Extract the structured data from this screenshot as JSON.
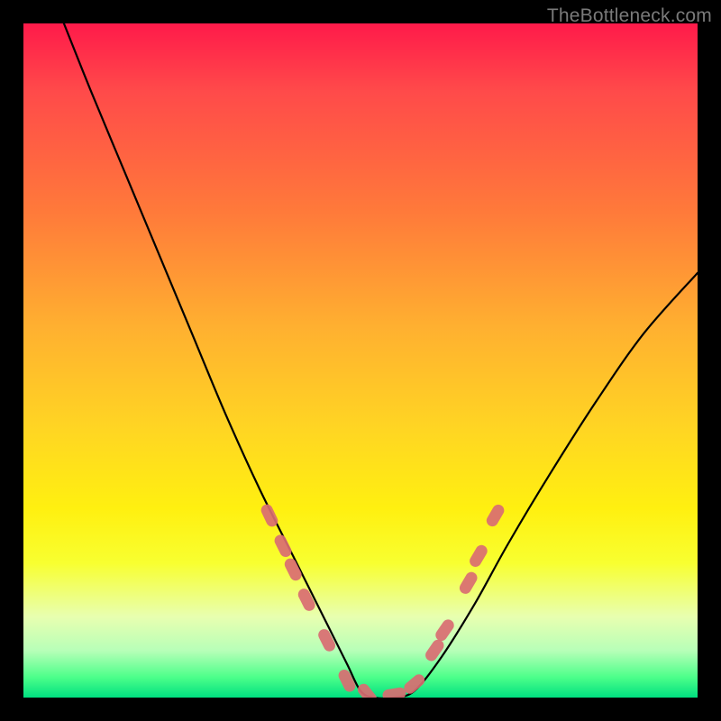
{
  "watermark": "TheBottleneck.com",
  "chart_data": {
    "type": "line",
    "title": "",
    "xlabel": "",
    "ylabel": "",
    "xlim": [
      0,
      100
    ],
    "ylim": [
      0,
      100
    ],
    "series": [
      {
        "name": "bottleneck-curve",
        "x": [
          6,
          10,
          15,
          20,
          25,
          30,
          35,
          40,
          45,
          48,
          50,
          52,
          55,
          58,
          62,
          67,
          72,
          78,
          85,
          92,
          100
        ],
        "y": [
          100,
          90,
          78,
          66,
          54,
          42,
          31,
          21,
          11,
          5,
          1,
          0,
          0,
          1,
          6,
          14,
          23,
          33,
          44,
          54,
          63
        ]
      }
    ],
    "markers": {
      "name": "highlighted-points",
      "color": "#d96d72",
      "points": [
        {
          "x": 36.5,
          "y": 27
        },
        {
          "x": 38.5,
          "y": 22.5
        },
        {
          "x": 40,
          "y": 19
        },
        {
          "x": 42,
          "y": 14.5
        },
        {
          "x": 45,
          "y": 8.5
        },
        {
          "x": 48,
          "y": 2.5
        },
        {
          "x": 51,
          "y": 0.5
        },
        {
          "x": 55,
          "y": 0.5
        },
        {
          "x": 58,
          "y": 2
        },
        {
          "x": 61,
          "y": 7
        },
        {
          "x": 62.5,
          "y": 10
        },
        {
          "x": 66,
          "y": 17
        },
        {
          "x": 67.5,
          "y": 21
        },
        {
          "x": 70,
          "y": 27
        }
      ]
    },
    "gradient_stops": [
      {
        "pos": 0,
        "color": "#ff1a4a"
      },
      {
        "pos": 10,
        "color": "#ff4a4a"
      },
      {
        "pos": 28,
        "color": "#ff7a3a"
      },
      {
        "pos": 45,
        "color": "#ffb030"
      },
      {
        "pos": 60,
        "color": "#ffd523"
      },
      {
        "pos": 72,
        "color": "#fff010"
      },
      {
        "pos": 80,
        "color": "#f8ff30"
      },
      {
        "pos": 88,
        "color": "#e8ffb0"
      },
      {
        "pos": 93,
        "color": "#b8ffb8"
      },
      {
        "pos": 97,
        "color": "#4cff8a"
      },
      {
        "pos": 100,
        "color": "#00e080"
      }
    ]
  }
}
